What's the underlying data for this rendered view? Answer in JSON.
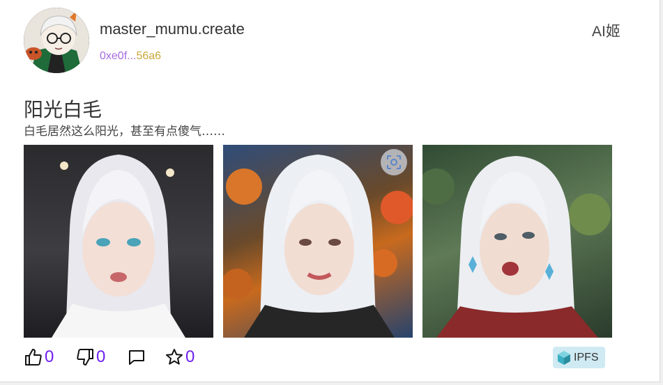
{
  "author": {
    "username": "master_mumu.create",
    "address_prefix": "0xe0f...",
    "address_suffix": "56a6"
  },
  "header": {
    "tag": "AI姬"
  },
  "post": {
    "title": "阳光白毛",
    "description": "白毛居然这么阳光，甚至有点傻气……"
  },
  "images": [
    {
      "icon": "portrait-image",
      "theme": "white-haired girl, dark studio background"
    },
    {
      "icon": "portrait-image",
      "theme": "white-haired girl, autumn maple leaves"
    },
    {
      "icon": "portrait-image",
      "theme": "white-haired girl, green foliage"
    }
  ],
  "actions": {
    "likes": "0",
    "dislikes": "0",
    "favorites": "0"
  },
  "storage": {
    "label": "IPFS"
  },
  "colors": {
    "count": "#6c1ff0",
    "address_prefix": "#a46be0",
    "address_suffix": "#c9a73b",
    "ipfs_bg": "#cfeaf2"
  }
}
